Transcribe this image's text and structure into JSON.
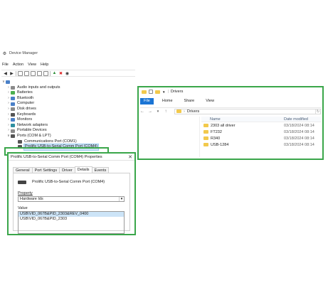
{
  "device_manager": {
    "title": "Device Manager",
    "menu": [
      "File",
      "Action",
      "View",
      "Help"
    ],
    "tree": [
      {
        "label": "Audio inputs and outputs",
        "icon": "speaker-icon",
        "color": "gray",
        "level": 1,
        "expanded": false
      },
      {
        "label": "Batteries",
        "icon": "battery-icon",
        "color": "green",
        "level": 1,
        "expanded": false
      },
      {
        "label": "Bluetooth",
        "icon": "bluetooth-icon",
        "color": "blue",
        "level": 1,
        "expanded": false
      },
      {
        "label": "Computer",
        "icon": "computer-icon",
        "color": "blue",
        "level": 1,
        "expanded": false
      },
      {
        "label": "Disk drives",
        "icon": "disk-icon",
        "color": "gray",
        "level": 1,
        "expanded": false
      },
      {
        "label": "Keyboards",
        "icon": "keyboard-icon",
        "color": "dark",
        "level": 1,
        "expanded": false
      },
      {
        "label": "Monitors",
        "icon": "monitor-icon",
        "color": "blue",
        "level": 1,
        "expanded": false
      },
      {
        "label": "Network adapters",
        "icon": "network-icon",
        "color": "teal",
        "level": 1,
        "expanded": false
      },
      {
        "label": "Portable Devices",
        "icon": "portable-device-icon",
        "color": "gray",
        "level": 1,
        "expanded": false
      },
      {
        "label": "Ports (COM & LPT)",
        "icon": "port-icon",
        "color": "dark",
        "level": 1,
        "expanded": true
      },
      {
        "label": "Communications Port (COM1)",
        "icon": "port-icon",
        "color": "dark",
        "level": 2,
        "expanded": null
      },
      {
        "label": "Prolific USB-to-Serial Comm Port (COM4)",
        "icon": "port-icon",
        "color": "dark",
        "level": 2,
        "expanded": null,
        "selected": true
      }
    ]
  },
  "properties": {
    "title": "Prolific USB-to-Serial Comm Port (COM4) Properties",
    "tabs": [
      "General",
      "Port Settings",
      "Driver",
      "Details",
      "Events"
    ],
    "active_tab": "Details",
    "device_name": "Prolific USB-to-Serial Comm Port (COM4)",
    "property_label": "Property",
    "property_value": "Hardware Ids",
    "value_label": "Value",
    "values": [
      "USB\\VID_067B&PID_2303&REV_0400",
      "USB\\VID_067B&PID_2303"
    ]
  },
  "explorer": {
    "title": "Drivers",
    "ribbon": [
      "File",
      "Home",
      "Share",
      "View"
    ],
    "path_label": "Drivers",
    "columns": {
      "name": "Name",
      "date": "Date modified"
    },
    "rows": [
      {
        "name": "2303 all driver",
        "date": "03/18/2024 08:14"
      },
      {
        "name": "FT232",
        "date": "03/18/2024 08:14"
      },
      {
        "name": "R340",
        "date": "03/18/2024 08:14"
      },
      {
        "name": "USB-1284",
        "date": "03/18/2024 08:14"
      }
    ],
    "folder_color": "#f2c94c"
  },
  "colors": {
    "highlight": "#3aa64a",
    "ribbon_file": "#1a74d4",
    "selection": "#cce4f7"
  }
}
